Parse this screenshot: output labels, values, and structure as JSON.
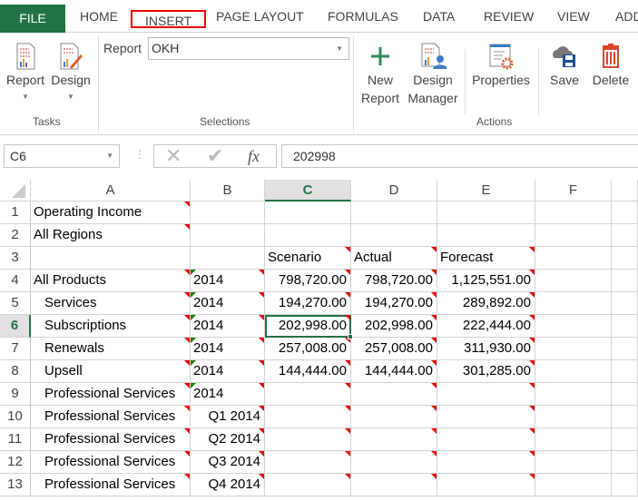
{
  "ribbon_tabs": [
    "FILE",
    "HOME",
    "INSERT",
    "PAGE LAYOUT",
    "FORMULAS",
    "DATA",
    "REVIEW",
    "VIEW",
    "ADD"
  ],
  "highlighted_tab": "INSERT",
  "ribbon": {
    "tasks": {
      "label": "Tasks",
      "report": "Report",
      "design": "Design"
    },
    "selections": {
      "label": "Selections",
      "report_label": "Report",
      "report_value": "OKH"
    },
    "actions": {
      "label": "Actions",
      "new_report": [
        "New",
        "Report"
      ],
      "design_manager": [
        "Design",
        "Manager"
      ],
      "properties": "Properties",
      "save": "Save",
      "delete": "Delete"
    }
  },
  "formula_bar": {
    "name_box": "C6",
    "formula": "202998",
    "fx": "fx"
  },
  "colors": {
    "accent": "#217346",
    "file_tab": "#217346",
    "comment_marker": "#e00000",
    "error_marker": "#1a7a1a",
    "highlight_border": "#e00000"
  },
  "sheet": {
    "columns": [
      "A",
      "B",
      "C",
      "D",
      "E",
      "F"
    ],
    "selected_cell": "C6",
    "rows": [
      {
        "n": "1",
        "cells": [
          "Operating Income",
          "",
          "",
          "",
          "",
          ""
        ]
      },
      {
        "n": "2",
        "cells": [
          "All Regions",
          "",
          "",
          "",
          "",
          ""
        ]
      },
      {
        "n": "3",
        "cells": [
          "",
          "",
          "Scenario",
          "Actual",
          "Forecast",
          ""
        ]
      },
      {
        "n": "4",
        "cells": [
          "All Products",
          "2014",
          "798,720.00",
          "798,720.00",
          "1,125,551.00",
          ""
        ]
      },
      {
        "n": "5",
        "cells": [
          "Services",
          "2014",
          "194,270.00",
          "194,270.00",
          "289,892.00",
          ""
        ]
      },
      {
        "n": "6",
        "cells": [
          "Subscriptions",
          "2014",
          "202,998.00",
          "202,998.00",
          "222,444.00",
          ""
        ]
      },
      {
        "n": "7",
        "cells": [
          "Renewals",
          "2014",
          "257,008.00",
          "257,008.00",
          "311,930.00",
          ""
        ]
      },
      {
        "n": "8",
        "cells": [
          "Upsell",
          "2014",
          "144,444.00",
          "144,444.00",
          "301,285.00",
          ""
        ]
      },
      {
        "n": "9",
        "cells": [
          "Professional Services",
          "2014",
          "",
          "",
          "",
          ""
        ]
      },
      {
        "n": "10",
        "cells": [
          "Professional Services",
          "Q1 2014",
          "",
          "",
          "",
          ""
        ]
      },
      {
        "n": "11",
        "cells": [
          "Professional Services",
          "Q2 2014",
          "",
          "",
          "",
          ""
        ]
      },
      {
        "n": "12",
        "cells": [
          "Professional Services",
          "Q3 2014",
          "",
          "",
          "",
          ""
        ]
      },
      {
        "n": "13",
        "cells": [
          "Professional Services",
          "Q4 2014",
          "",
          "",
          "",
          ""
        ]
      }
    ]
  }
}
